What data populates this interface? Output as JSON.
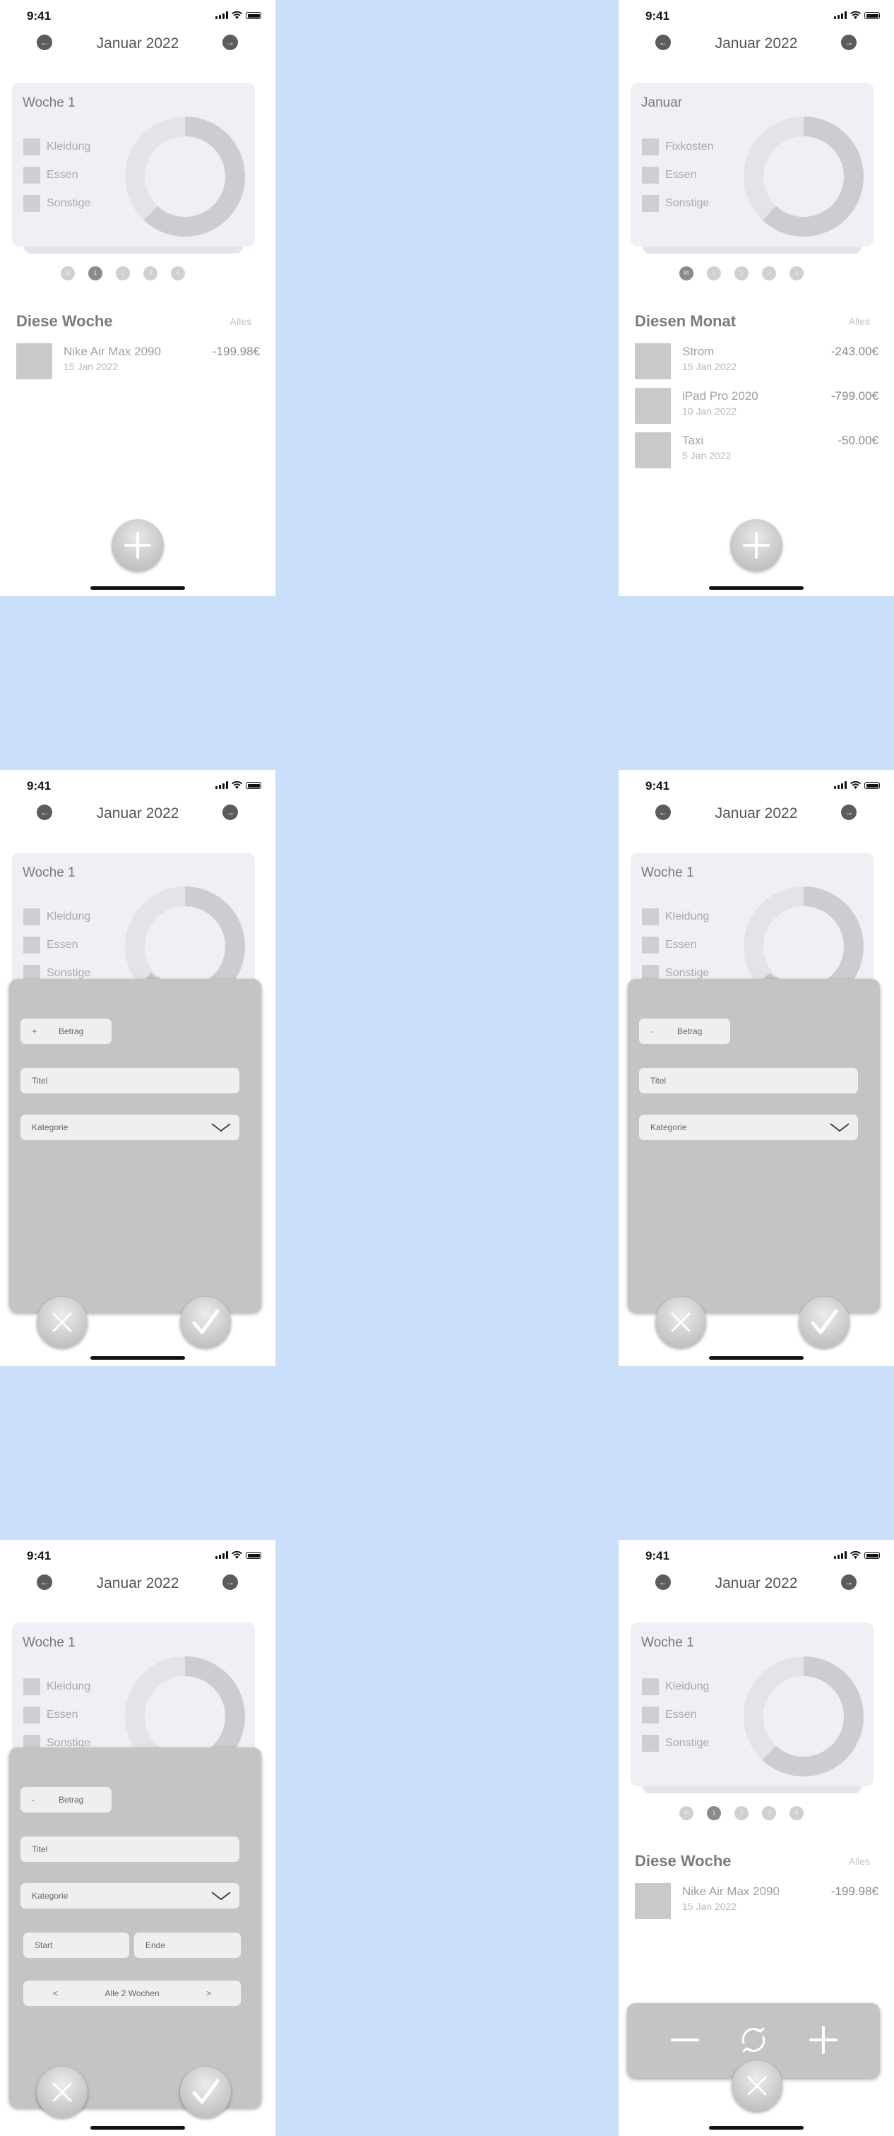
{
  "status": {
    "time": "9:41"
  },
  "header": {
    "month": "Januar 2022",
    "prev_icon": "arrow-left-icon",
    "next_icon": "arrow-right-icon"
  },
  "week_card": {
    "title": "Woche 1",
    "legend": [
      "Kleidung",
      "Essen",
      "Sonstige"
    ],
    "share_main": 0.62,
    "share_secondary": 0.12
  },
  "month_card": {
    "title": "Januar",
    "legend": [
      "Fixkosten",
      "Essen",
      "Sonstige"
    ]
  },
  "pager": {
    "labels": [
      "M",
      "1",
      "2",
      "3",
      "4"
    ],
    "week_active": 1,
    "month_active": 0
  },
  "week_section": {
    "title": "Diese Woche",
    "link": "Alles",
    "items": [
      {
        "title": "Nike Air Max 2090",
        "date": "15 Jan 2022",
        "amount": "-199.98€"
      }
    ]
  },
  "month_section": {
    "title": "Diesen Monat",
    "link": "Alles",
    "items": [
      {
        "title": "Strom",
        "date": "15 Jan 2022",
        "amount": "-243.00€"
      },
      {
        "title": "iPad Pro 2020",
        "date": "10 Jan 2022",
        "amount": "-799.00€"
      },
      {
        "title": "Taxi",
        "date": "5 Jan 2022",
        "amount": "-50.00€"
      }
    ]
  },
  "form": {
    "sign_plus": "+",
    "sign_minus": "-",
    "amount_label": "Betrag",
    "title_label": "Titel",
    "category_label": "Kategorie",
    "start_label": "Start",
    "end_label": "Ende",
    "repeat_prev": "<",
    "repeat_label": "Alle 2 Wochen",
    "repeat_next": ">"
  },
  "icons": {
    "add": "plus-icon",
    "cancel": "close-icon",
    "confirm": "checkmark-icon",
    "minus": "minus-icon",
    "recurring": "repeat-icon",
    "dropdown": "chevron-down-icon"
  }
}
